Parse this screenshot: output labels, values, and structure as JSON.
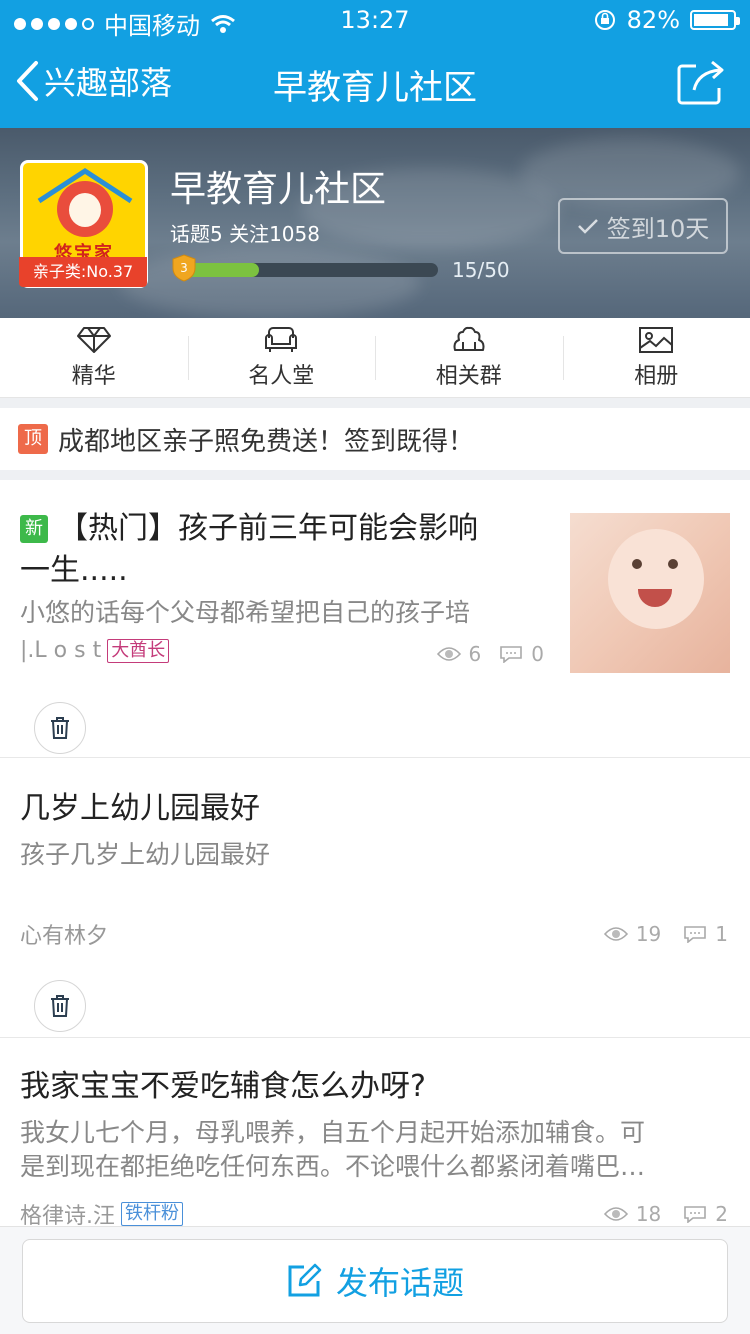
{
  "statusbar": {
    "carrier": "中国移动",
    "time": "13:27",
    "battery": "82%"
  },
  "nav": {
    "back_label": "兴趣部落",
    "title": "早教育儿社区"
  },
  "group": {
    "name": "早教育儿社区",
    "stats": "话题5  关注1058",
    "logo_text": "悠宝家",
    "rank": "亲子类:No.37",
    "level": "3",
    "progress_text": "15/50",
    "progress_fraction": 0.3,
    "signin_label": "签到10天"
  },
  "menu": [
    {
      "label": "精华",
      "icon": "diamond-icon"
    },
    {
      "label": "名人堂",
      "icon": "sofa-icon"
    },
    {
      "label": "相关群",
      "icon": "group-icon"
    },
    {
      "label": "相册",
      "icon": "image-icon"
    }
  ],
  "notice": {
    "tag": "顶",
    "text": "成都地区亲子照免费送！签到既得！"
  },
  "posts": [
    {
      "tag": "新",
      "title_line1": "【热门】孩子前三年可能会影响",
      "title_line2": "一生.....",
      "summary": "小悠的话每个父母都希望把自己的孩子培",
      "author": "|.L o s t",
      "author_badge": "大酋长",
      "views": "6",
      "comments": "0"
    },
    {
      "title_line1": "几岁上幼儿园最好",
      "summary": "孩子几岁上幼儿园最好",
      "author": "心有林夕",
      "views": "19",
      "comments": "1"
    },
    {
      "title_line1": "我家宝宝不爱吃辅食怎么办呀?",
      "summary_line1": "我女儿七个月，母乳喂养，自五个月起开始添加辅食。可",
      "summary_line2": "是到现在都拒绝吃任何东西。不论喂什么都紧闭着嘴巴…",
      "author": "格律诗.汪",
      "author_badge": "铁杆粉",
      "views": "18",
      "comments": "2"
    }
  ],
  "bottom": {
    "publish_label": "发布话题"
  },
  "colors": {
    "brand": "#12a0e2",
    "progress": "#7cc240",
    "top_tag": "#ee6a4a",
    "new_tag": "#3db94a"
  }
}
